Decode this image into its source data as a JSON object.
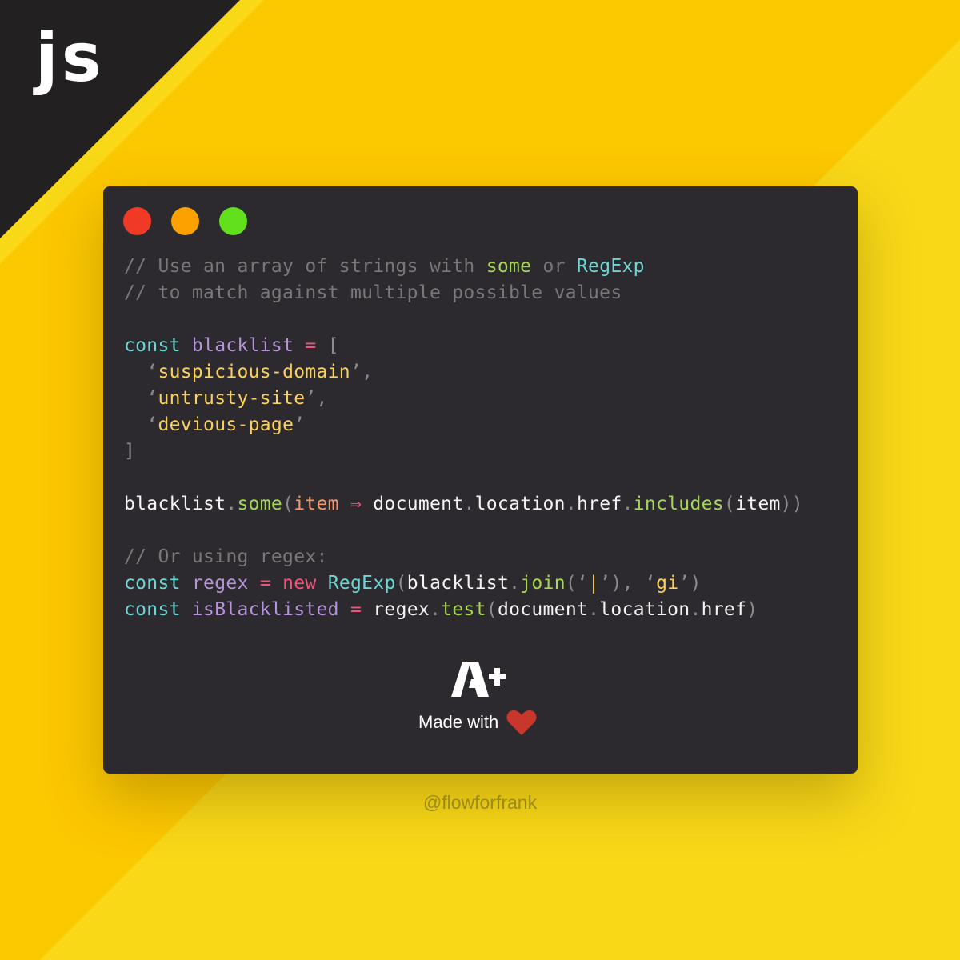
{
  "logo": {
    "text": "js"
  },
  "window": {
    "controls": [
      {
        "name": "close",
        "color": "#f13a26"
      },
      {
        "name": "minimize",
        "color": "#fba100"
      },
      {
        "name": "maximize",
        "color": "#63e01c"
      }
    ]
  },
  "code": {
    "lines": [
      [
        {
          "t": "// Use an array of strings with ",
          "c": "com"
        },
        {
          "t": "some",
          "c": "fn"
        },
        {
          "t": " or ",
          "c": "com"
        },
        {
          "t": "RegExp",
          "c": "kw"
        }
      ],
      [
        {
          "t": "// to match against multiple possible values",
          "c": "com"
        }
      ],
      [],
      [
        {
          "t": "const",
          "c": "kw"
        },
        {
          "t": " ",
          "c": "plain"
        },
        {
          "t": "blacklist",
          "c": "var"
        },
        {
          "t": " ",
          "c": "plain"
        },
        {
          "t": "=",
          "c": "op"
        },
        {
          "t": " ",
          "c": "plain"
        },
        {
          "t": "[",
          "c": "punc"
        }
      ],
      [
        {
          "t": "  ‘",
          "c": "punc"
        },
        {
          "t": "suspicious-domain",
          "c": "str"
        },
        {
          "t": "’,",
          "c": "punc"
        }
      ],
      [
        {
          "t": "  ‘",
          "c": "punc"
        },
        {
          "t": "untrusty-site",
          "c": "str"
        },
        {
          "t": "’,",
          "c": "punc"
        }
      ],
      [
        {
          "t": "  ‘",
          "c": "punc"
        },
        {
          "t": "devious-page",
          "c": "str"
        },
        {
          "t": "’",
          "c": "punc"
        }
      ],
      [
        {
          "t": "]",
          "c": "punc"
        }
      ],
      [],
      [
        {
          "t": "blacklist",
          "c": "plain"
        },
        {
          "t": ".",
          "c": "punc"
        },
        {
          "t": "some",
          "c": "fn"
        },
        {
          "t": "(",
          "c": "punc"
        },
        {
          "t": "item",
          "c": "param"
        },
        {
          "t": " ",
          "c": "plain"
        },
        {
          "t": "⇒",
          "c": "op"
        },
        {
          "t": " document",
          "c": "plain"
        },
        {
          "t": ".",
          "c": "punc"
        },
        {
          "t": "location",
          "c": "plain"
        },
        {
          "t": ".",
          "c": "punc"
        },
        {
          "t": "href",
          "c": "plain"
        },
        {
          "t": ".",
          "c": "punc"
        },
        {
          "t": "includes",
          "c": "fn"
        },
        {
          "t": "(",
          "c": "punc"
        },
        {
          "t": "item",
          "c": "plain"
        },
        {
          "t": "))",
          "c": "punc"
        }
      ],
      [],
      [
        {
          "t": "// Or using regex:",
          "c": "com"
        }
      ],
      [
        {
          "t": "const",
          "c": "kw"
        },
        {
          "t": " ",
          "c": "plain"
        },
        {
          "t": "regex",
          "c": "var"
        },
        {
          "t": " ",
          "c": "plain"
        },
        {
          "t": "=",
          "c": "op"
        },
        {
          "t": " ",
          "c": "plain"
        },
        {
          "t": "new",
          "c": "op"
        },
        {
          "t": " ",
          "c": "plain"
        },
        {
          "t": "RegExp",
          "c": "kw"
        },
        {
          "t": "(",
          "c": "punc"
        },
        {
          "t": "blacklist",
          "c": "plain"
        },
        {
          "t": ".",
          "c": "punc"
        },
        {
          "t": "join",
          "c": "fn"
        },
        {
          "t": "(‘",
          "c": "punc"
        },
        {
          "t": "|",
          "c": "pipe"
        },
        {
          "t": "’), ‘",
          "c": "punc"
        },
        {
          "t": "gi",
          "c": "str"
        },
        {
          "t": "’)",
          "c": "punc"
        }
      ],
      [
        {
          "t": "const",
          "c": "kw"
        },
        {
          "t": " ",
          "c": "plain"
        },
        {
          "t": "isBlacklisted",
          "c": "var"
        },
        {
          "t": " ",
          "c": "plain"
        },
        {
          "t": "=",
          "c": "op"
        },
        {
          "t": " regex",
          "c": "plain"
        },
        {
          "t": ".",
          "c": "punc"
        },
        {
          "t": "test",
          "c": "fn"
        },
        {
          "t": "(",
          "c": "punc"
        },
        {
          "t": "document",
          "c": "plain"
        },
        {
          "t": ".",
          "c": "punc"
        },
        {
          "t": "location",
          "c": "plain"
        },
        {
          "t": ".",
          "c": "punc"
        },
        {
          "t": "href",
          "c": "plain"
        },
        {
          "t": ")",
          "c": "punc"
        }
      ]
    ]
  },
  "branding": {
    "logo_text": "A+",
    "made_with": "Made with",
    "heart_icon": "heart-icon",
    "heart_color": "#c9372c"
  },
  "handle": "@flowforfrank"
}
